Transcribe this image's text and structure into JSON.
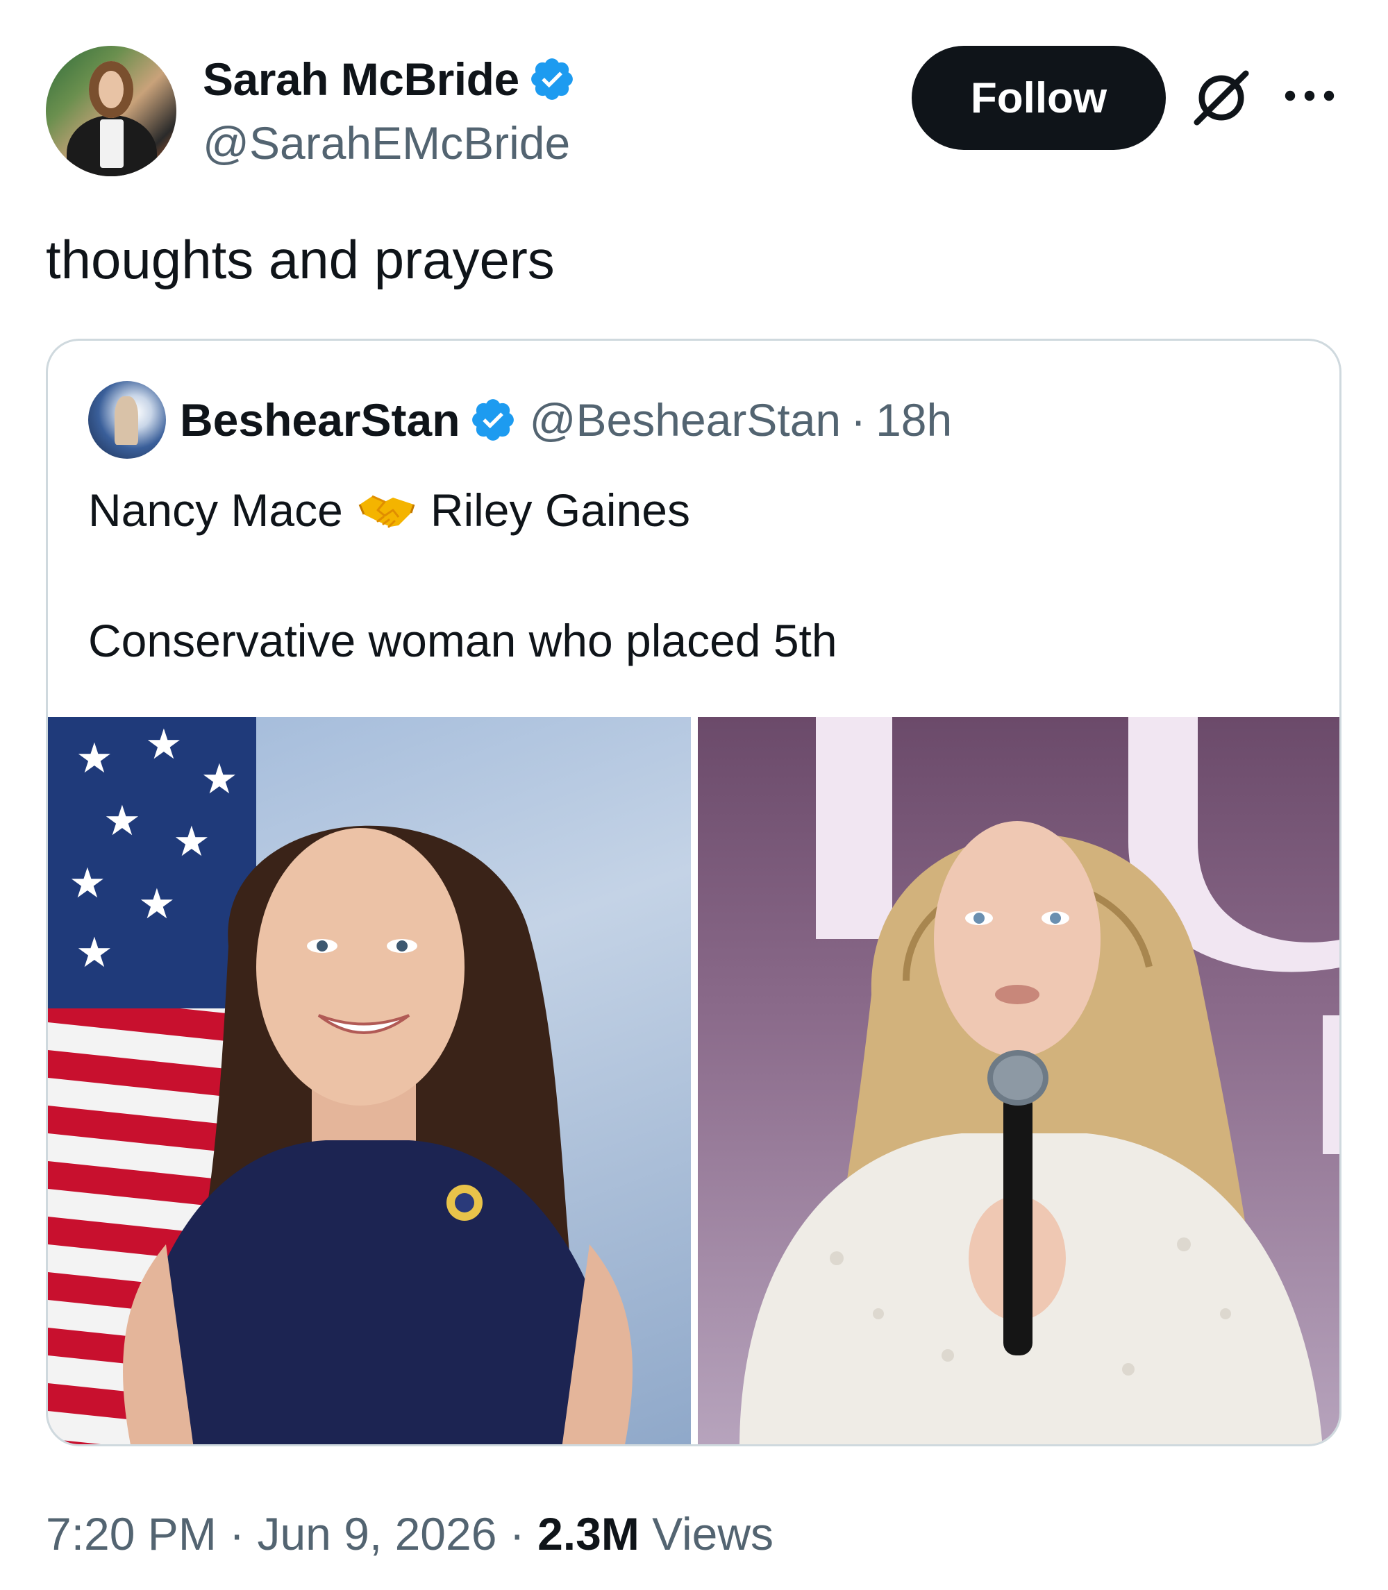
{
  "author": {
    "display_name": "Sarah McBride",
    "handle": "@SarahEMcBride",
    "verified": true
  },
  "actions": {
    "follow_label": "Follow"
  },
  "tweet": {
    "text": "thoughts and prayers"
  },
  "quote": {
    "display_name": "BeshearStan",
    "handle": "@BeshearStan",
    "separator": "·",
    "time": "18h",
    "verified": true,
    "line1_left": "Nancy Mace",
    "line1_emoji": "handshake",
    "line1_right": "Riley Gaines",
    "line2": "Conservative woman who placed 5th"
  },
  "meta": {
    "time": "7:20 PM",
    "sep1": "·",
    "date": "Jun 9, 2026",
    "sep2": "·",
    "views_count": "2.3M",
    "views_label": "Views"
  },
  "icons": [
    "verified-badge-icon",
    "grok-icon",
    "more-icon",
    "handshake-icon"
  ],
  "colors": {
    "text": "#0f1419",
    "secondary": "#536471",
    "verified": "#1d9bf0",
    "border": "#cfd9de",
    "follow_bg": "#0f1419"
  }
}
